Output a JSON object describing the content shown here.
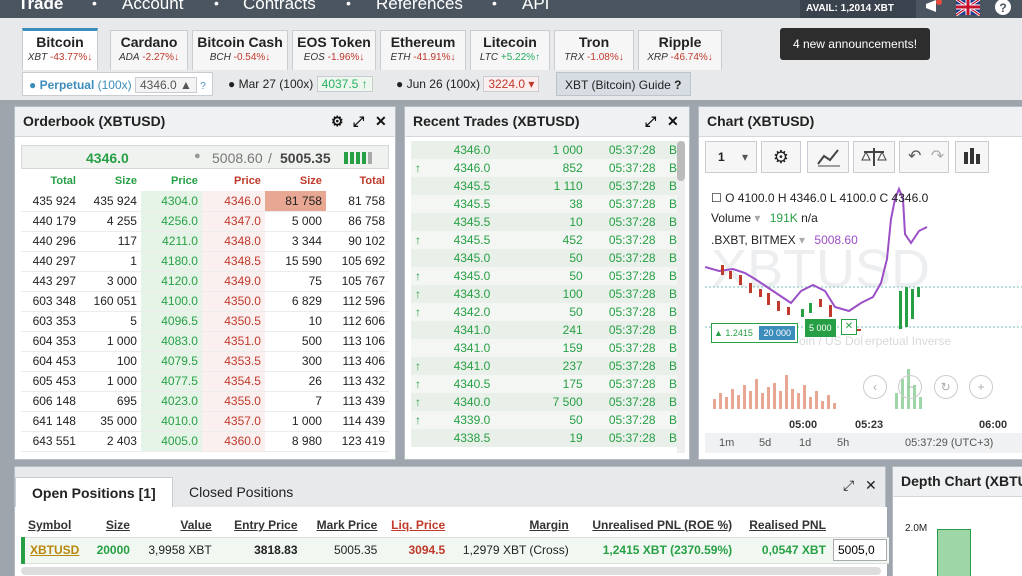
{
  "nav": {
    "items": [
      "Trade",
      "Account",
      "Contracts",
      "References",
      "API"
    ],
    "avail_label": "AVAIL:",
    "avail_value": "1,2014 XBT"
  },
  "announcement": "4 new announcements!",
  "contracts": [
    {
      "name": "Bitcoin",
      "sym": "XBT",
      "chg": "-43.77%",
      "dir": "down",
      "active": true
    },
    {
      "name": "Cardano",
      "sym": "ADA",
      "chg": "-2.27%",
      "dir": "down"
    },
    {
      "name": "Bitcoin Cash",
      "sym": "BCH",
      "chg": "-0.54%",
      "dir": "down"
    },
    {
      "name": "EOS Token",
      "sym": "EOS",
      "chg": "-1.96%",
      "dir": "down"
    },
    {
      "name": "Ethereum",
      "sym": "ETH",
      "chg": "-41.91%",
      "dir": "down"
    },
    {
      "name": "Litecoin",
      "sym": "LTC",
      "chg": "+5.22%",
      "dir": "up"
    },
    {
      "name": "Tron",
      "sym": "TRX",
      "chg": "-1.08%",
      "dir": "down"
    },
    {
      "name": "Ripple",
      "sym": "XRP",
      "chg": "-46.74%",
      "dir": "down"
    }
  ],
  "subtabs": {
    "perpetual_label": "Perpetual",
    "perpetual_lev": "(100x)",
    "perpetual_price": "4346.0",
    "mar_label": "Mar 27 (100x)",
    "mar_price": "4037.5",
    "jun_label": "Jun 26 (100x)",
    "jun_price": "3224.0",
    "guide": "XBT (Bitcoin) Guide"
  },
  "orderbook": {
    "title": "Orderbook (XBTUSD)",
    "last_price": "4346.0",
    "index_price": "5008.60",
    "mark_sep": "/",
    "mark_price": "5005.35",
    "headers": [
      "Total",
      "Size",
      "Price",
      "Price",
      "Size",
      "Total"
    ],
    "rows": [
      [
        "435 924",
        "435 924",
        "4304.0",
        "4346.0",
        "81 758",
        "81 758"
      ],
      [
        "440 179",
        "4 255",
        "4256.0",
        "4347.0",
        "5 000",
        "86 758"
      ],
      [
        "440 296",
        "117",
        "4211.0",
        "4348.0",
        "3 344",
        "90 102"
      ],
      [
        "440 297",
        "1",
        "4180.0",
        "4348.5",
        "15 590",
        "105 692"
      ],
      [
        "443 297",
        "3 000",
        "4120.0",
        "4349.0",
        "75",
        "105 767"
      ],
      [
        "603 348",
        "160 051",
        "4100.0",
        "4350.0",
        "6 829",
        "112 596"
      ],
      [
        "603 353",
        "5",
        "4096.5",
        "4350.5",
        "10",
        "112 606"
      ],
      [
        "604 353",
        "1 000",
        "4083.0",
        "4351.0",
        "500",
        "113 106"
      ],
      [
        "604 453",
        "100",
        "4079.5",
        "4353.5",
        "300",
        "113 406"
      ],
      [
        "605 453",
        "1 000",
        "4077.5",
        "4354.5",
        "26",
        "113 432"
      ],
      [
        "606 148",
        "695",
        "4023.0",
        "4355.0",
        "7",
        "113 439"
      ],
      [
        "641 148",
        "35 000",
        "4010.0",
        "4357.0",
        "1 000",
        "114 439"
      ],
      [
        "643 551",
        "2 403",
        "4005.0",
        "4360.0",
        "8 980",
        "123 419"
      ]
    ]
  },
  "trades": {
    "title": "Recent Trades (XBTUSD)",
    "rows": [
      [
        "4346.0",
        "1 000",
        "05:37:28",
        "B",
        false
      ],
      [
        "4346.0",
        "852",
        "05:37:28",
        "B",
        true
      ],
      [
        "4345.5",
        "1 110",
        "05:37:28",
        "B",
        false
      ],
      [
        "4345.5",
        "38",
        "05:37:28",
        "B",
        false
      ],
      [
        "4345.5",
        "10",
        "05:37:28",
        "B",
        false
      ],
      [
        "4345.5",
        "452",
        "05:37:28",
        "B",
        true
      ],
      [
        "4345.0",
        "50",
        "05:37:28",
        "B",
        false
      ],
      [
        "4345.0",
        "50",
        "05:37:28",
        "B",
        true
      ],
      [
        "4343.0",
        "100",
        "05:37:28",
        "B",
        true
      ],
      [
        "4342.0",
        "50",
        "05:37:28",
        "B",
        true
      ],
      [
        "4341.0",
        "241",
        "05:37:28",
        "B",
        false
      ],
      [
        "4341.0",
        "159",
        "05:37:28",
        "B",
        false
      ],
      [
        "4341.0",
        "237",
        "05:37:28",
        "B",
        true
      ],
      [
        "4340.5",
        "175",
        "05:37:28",
        "B",
        true
      ],
      [
        "4340.0",
        "7 500",
        "05:37:28",
        "B",
        true
      ],
      [
        "4339.0",
        "50",
        "05:37:28",
        "B",
        true
      ],
      [
        "4338.5",
        "19",
        "05:37:28",
        "B",
        false
      ]
    ]
  },
  "chart": {
    "title": "Chart (XBTUSD)",
    "interval": "1",
    "ohlc": {
      "o_label": "O",
      "o": "4100.0",
      "h_label": "H",
      "h": "4346.0",
      "l_label": "L",
      "l": "4100.0",
      "c_label": "C",
      "c": "4346.0"
    },
    "volume_label": "Volume",
    "volume_value": "191K",
    "volume_na": "n/a",
    "index_label": ".BXBT, BITMEX",
    "index_value": "5008.60",
    "watermark": "XBTUSD",
    "watermark_sub": "oin / US Dol",
    "watermark_sub2": "erpetual Inverse",
    "tag_pnl": "▲ 1.2415",
    "tag_size": "20 000",
    "tag_qty": "5 000",
    "xlabels": [
      "05:00",
      "05:23",
      "06:00"
    ],
    "ranges": [
      "1m",
      "5d",
      "1d",
      "5h"
    ],
    "clock": "05:37:29 (UTC+3)"
  },
  "positions": {
    "tab_open": "Open Positions [1]",
    "tab_closed": "Closed Positions",
    "headers": [
      "Symbol",
      "Size",
      "Value",
      "Entry Price",
      "Mark Price",
      "Liq. Price",
      "Margin",
      "Unrealised PNL (ROE %)",
      "Realised PNL"
    ],
    "row": {
      "symbol": "XBTUSD",
      "size": "20000",
      "value": "3,9958 XBT",
      "entry": "3818.83",
      "mark": "5005.35",
      "liq": "3094.5",
      "margin": "1,2979 XBT (Cross)",
      "upnl": "1,2415 XBT (2370.59%)",
      "rpnl": "0,0547 XBT",
      "close_input": "5005,0"
    }
  },
  "depth": {
    "title": "Depth Chart (XBTUSD)",
    "ylabel": "2.0M"
  }
}
